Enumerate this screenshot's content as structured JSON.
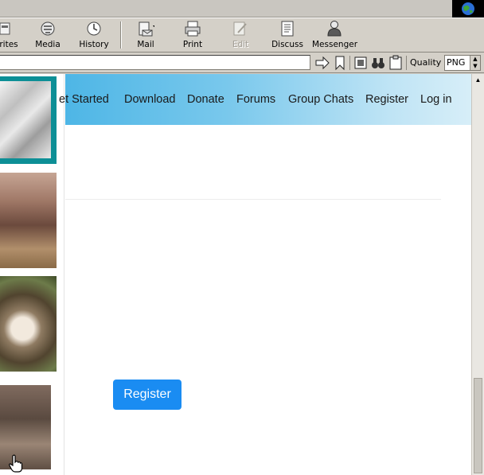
{
  "toolbar": {
    "favorites_label": "rites",
    "media_label": "Media",
    "history_label": "History",
    "mail_label": "Mail",
    "print_label": "Print",
    "edit_label": "Edit",
    "discuss_label": "Discuss",
    "messenger_label": "Messenger"
  },
  "address_bar": {
    "url_value": "",
    "quality_label": "Quality",
    "quality_value": "PNG"
  },
  "site_nav": {
    "get_started": "et Started",
    "download": "Download",
    "donate": "Donate",
    "forums": "Forums",
    "group_chats": "Group Chats",
    "register": "Register",
    "login": "Log in"
  },
  "main": {
    "register_button": "Register"
  },
  "colors": {
    "register_button_bg": "#1a8cf2",
    "nav_gradient_start": "#4eb6e6",
    "thumb_frame": "#0d8f96"
  },
  "icons": {
    "throbber": "globe-icon",
    "cursor": "hand-pointer-icon"
  }
}
